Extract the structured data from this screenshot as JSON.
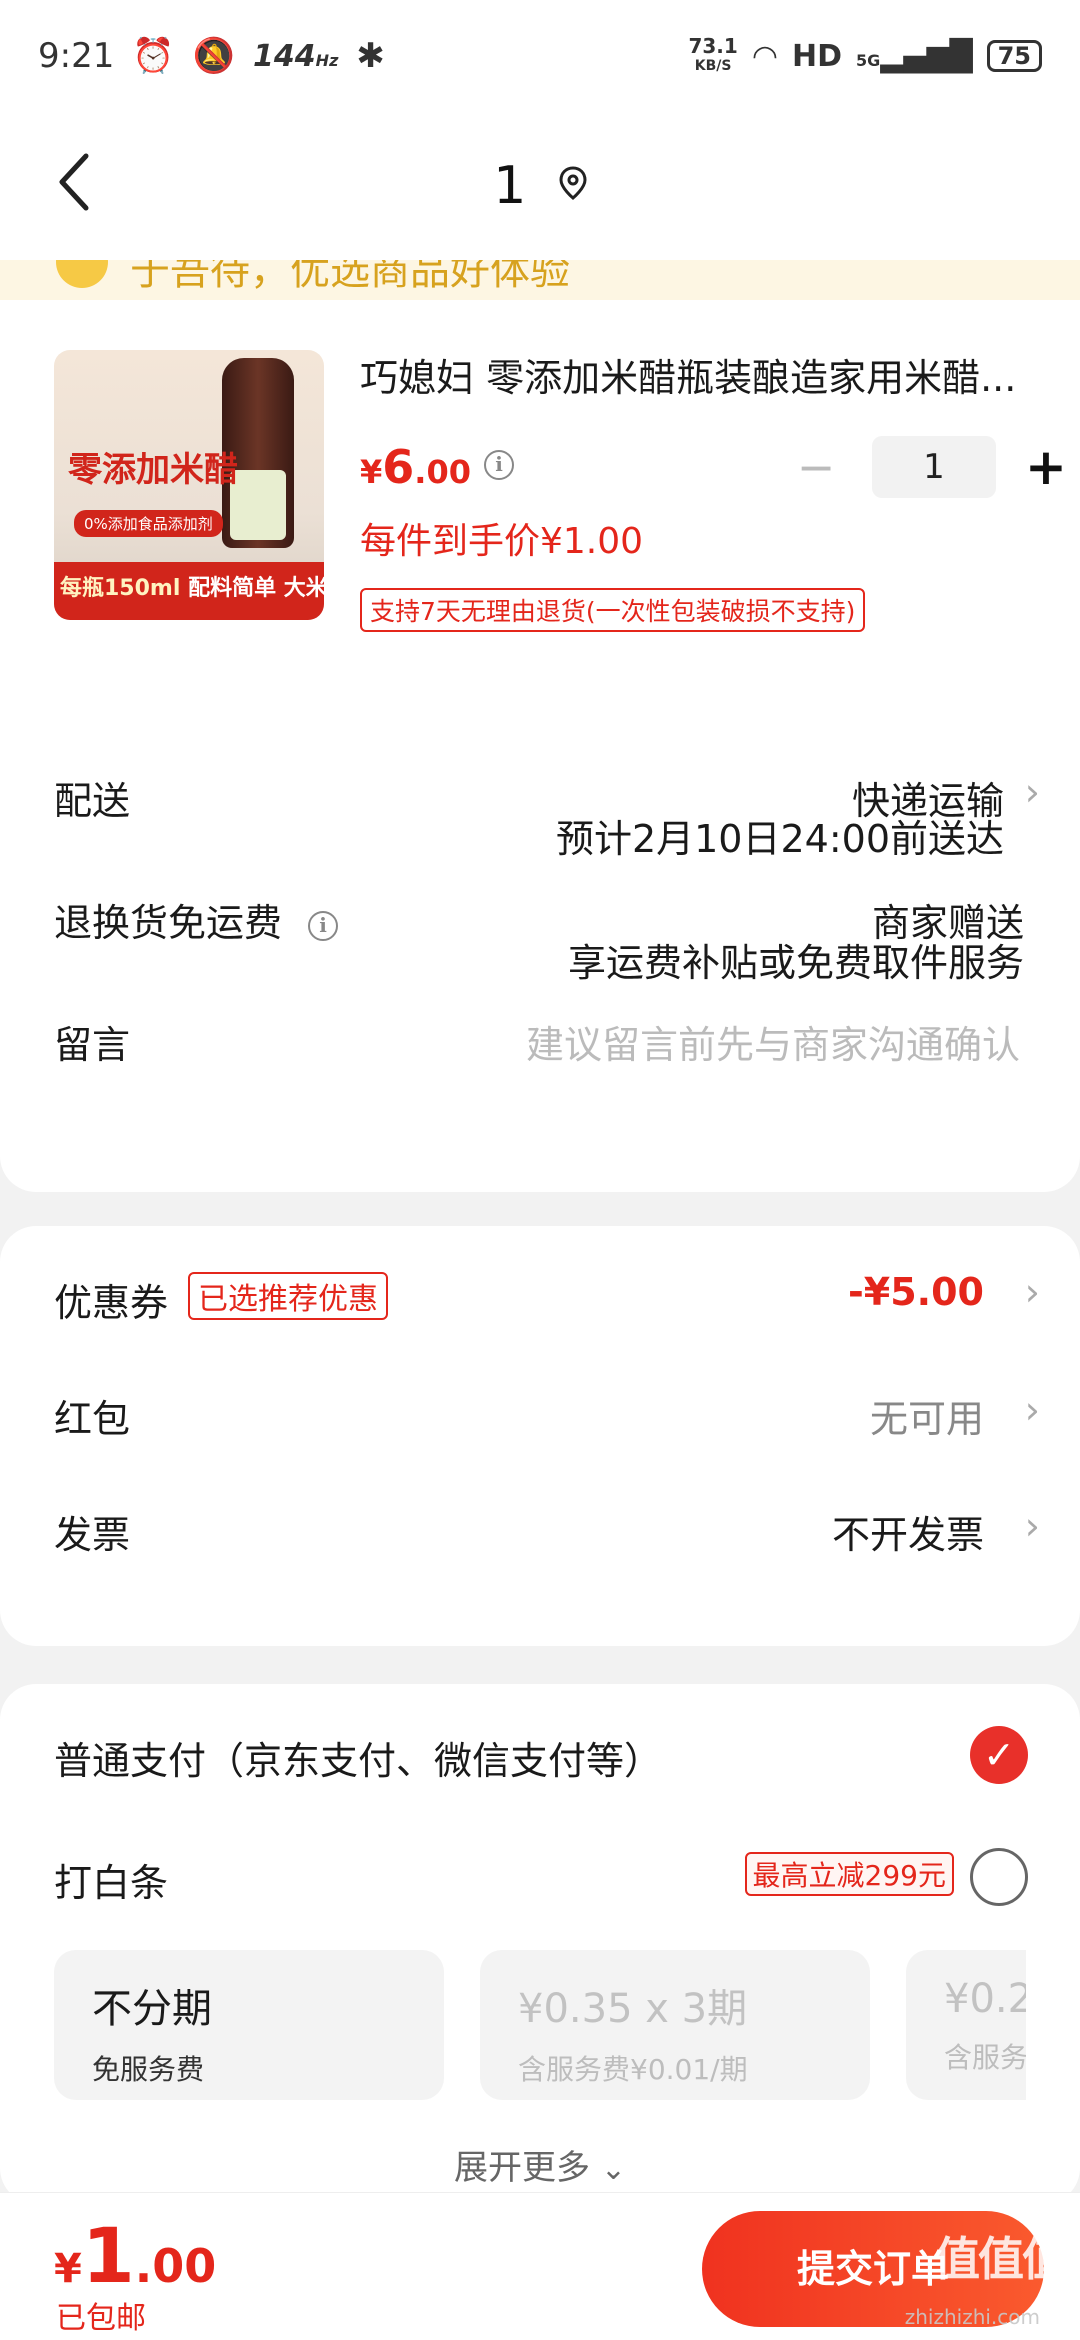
{
  "status_bar": {
    "time": "9:21",
    "refresh": "144",
    "refresh_unit": "Hz",
    "speed_value": "73.1",
    "speed_unit": "KB/S",
    "hd": "HD",
    "network": "5G",
    "battery": "75"
  },
  "nav": {
    "back_icon": "chevron-left-icon",
    "title": "1",
    "location_icon": "location-pin-icon"
  },
  "notice": {
    "text": "于吾待，优选商品好体验"
  },
  "product": {
    "image": {
      "headline": "零添加米醋",
      "sub": "0%添加食品添加剂",
      "footer_left": "每瓶150ml",
      "footer_right": "配料简单 大米酿造"
    },
    "title": "巧媳妇 零添加米醋瓶装酿造家用米醋...",
    "price_currency": "¥",
    "price_int": "6",
    "price_dec": ".00",
    "unit_price": "每件到手价¥1.00",
    "return_policy": "支持7天无理由退货(一次性包装破损不支持)",
    "quantity": "1",
    "minus": "−",
    "plus": "+"
  },
  "delivery": {
    "label": "配送",
    "method": "快递运输",
    "eta": "预计2月10日24:00前送达"
  },
  "return_shipping": {
    "label": "退换货免运费",
    "value": "商家赠送",
    "desc": "享运费补贴或免费取件服务"
  },
  "message": {
    "label": "留言",
    "placeholder": "建议留言前先与商家沟通确认"
  },
  "coupon": {
    "label": "优惠券",
    "badge": "已选推荐优惠",
    "value": "-¥5.00"
  },
  "red_packet": {
    "label": "红包",
    "value": "无可用"
  },
  "invoice": {
    "label": "发票",
    "value": "不开发票"
  },
  "payment": {
    "normal_label": "普通支付（京东支付、微信支付等）",
    "baitiao_label": "打白条",
    "baitiao_badge": "最高立减299元",
    "plans": [
      {
        "title": "不分期",
        "sub": "免服务费"
      },
      {
        "title": "¥0.35 x 3期",
        "sub": "含服务费¥0.01/期"
      },
      {
        "title": "¥0.2",
        "sub": "含服务"
      }
    ],
    "expand": "展开更多"
  },
  "bottom": {
    "currency": "¥",
    "total_int": "1",
    "total_dec": ".00",
    "shipping": "已包邮",
    "submit": "提交订单",
    "watermark": "值值值",
    "watermark_url": "zhizhizhi.com"
  },
  "colors": {
    "accent": "#e4261b",
    "check": "#e8302a"
  }
}
